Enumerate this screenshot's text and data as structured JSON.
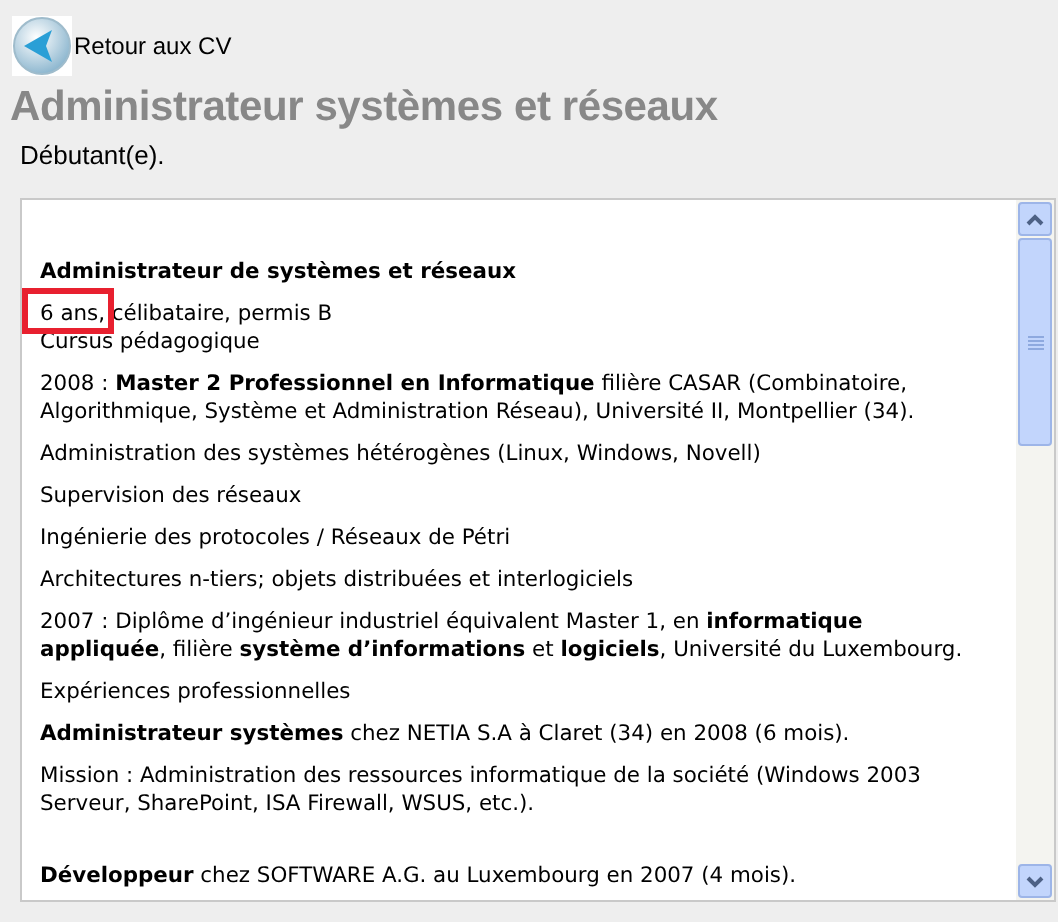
{
  "back_link": {
    "label": "Retour aux CV"
  },
  "title": "Administrateur systèmes et réseaux",
  "level": "Débutant(e).",
  "content": [
    {
      "text": "**Administrateur de systèmes et réseaux**",
      "highlighted": false
    },
    {
      "text": "6 ans, célibataire, permis B\nCursus pédagogique",
      "highlighted": true
    },
    {
      "text": "2008 : **Master 2 Professionnel en Informatique** filière CASAR (Combinatoire, Algorithmique, Système et Administration Réseau), Université II, Montpellier (34).",
      "highlighted": false
    },
    {
      "text": "Administration des systèmes hétérogènes (Linux, Windows, Novell)",
      "highlighted": false
    },
    {
      "text": "Supervision des réseaux",
      "highlighted": false
    },
    {
      "text": "Ingénierie des protocoles / Réseaux de Pétri",
      "highlighted": false
    },
    {
      "text": "Architectures n-tiers; objets distribuées et interlogiciels",
      "highlighted": false
    },
    {
      "text": "2007 : Diplôme d’ingénieur industriel équivalent Master 1, en **informatique appliquée**, filière **système d’informations** et **logiciels**, Université du Luxembourg.",
      "highlighted": false
    },
    {
      "text": "Expériences professionnelles",
      "highlighted": false
    },
    {
      "text": "**Administrateur systèmes** chez NETIA S.A à Claret (34) en 2008 (6 mois).",
      "highlighted": false
    },
    {
      "text": "Mission : Administration des ressources informatique de la société (Windows 2003 Serveur, SharePoint, ISA Firewall, WSUS, etc.).",
      "highlighted": false
    },
    {
      "text": "**Développeur** chez SOFTWARE A.G. au Luxembourg en 2007 (4 mois).",
      "highlighted": false
    }
  ]
}
